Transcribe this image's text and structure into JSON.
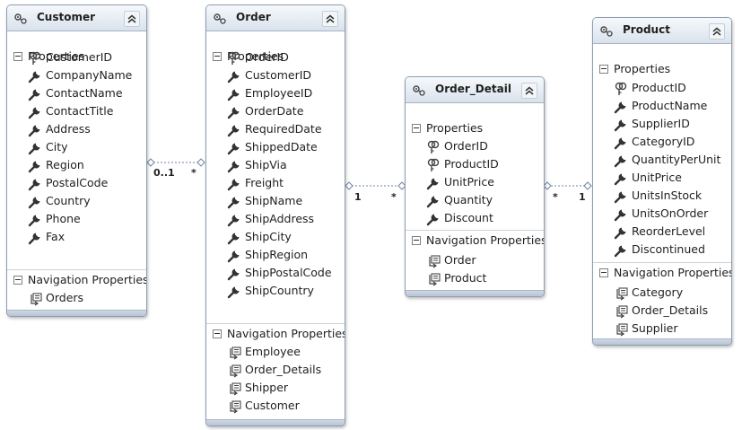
{
  "colors": {
    "header_top": "#f6f9fc",
    "header_bottom": "#d9e2ec",
    "border": "#8c9db3",
    "connector": "#6f86a3"
  },
  "section_labels": {
    "properties": "Properties",
    "navigation": "Navigation Properties"
  },
  "entities": {
    "customer": {
      "name": "Customer",
      "properties": [
        {
          "name": "CustomerID",
          "icon": "key-icon"
        },
        {
          "name": "CompanyName",
          "icon": "wrench-icon"
        },
        {
          "name": "ContactName",
          "icon": "wrench-icon"
        },
        {
          "name": "ContactTitle",
          "icon": "wrench-icon"
        },
        {
          "name": "Address",
          "icon": "wrench-icon"
        },
        {
          "name": "City",
          "icon": "wrench-icon"
        },
        {
          "name": "Region",
          "icon": "wrench-icon"
        },
        {
          "name": "PostalCode",
          "icon": "wrench-icon"
        },
        {
          "name": "Country",
          "icon": "wrench-icon"
        },
        {
          "name": "Phone",
          "icon": "wrench-icon"
        },
        {
          "name": "Fax",
          "icon": "wrench-icon"
        }
      ],
      "navigation": [
        "Orders"
      ]
    },
    "order": {
      "name": "Order",
      "properties": [
        {
          "name": "OrderID",
          "icon": "key-icon"
        },
        {
          "name": "CustomerID",
          "icon": "wrench-icon"
        },
        {
          "name": "EmployeeID",
          "icon": "wrench-icon"
        },
        {
          "name": "OrderDate",
          "icon": "wrench-icon"
        },
        {
          "name": "RequiredDate",
          "icon": "wrench-icon"
        },
        {
          "name": "ShippedDate",
          "icon": "wrench-icon"
        },
        {
          "name": "ShipVia",
          "icon": "wrench-icon"
        },
        {
          "name": "Freight",
          "icon": "wrench-icon"
        },
        {
          "name": "ShipName",
          "icon": "wrench-icon"
        },
        {
          "name": "ShipAddress",
          "icon": "wrench-icon"
        },
        {
          "name": "ShipCity",
          "icon": "wrench-icon"
        },
        {
          "name": "ShipRegion",
          "icon": "wrench-icon"
        },
        {
          "name": "ShipPostalCode",
          "icon": "wrench-icon"
        },
        {
          "name": "ShipCountry",
          "icon": "wrench-icon"
        }
      ],
      "navigation": [
        "Employee",
        "Order_Details",
        "Shipper",
        "Customer"
      ]
    },
    "order_detail": {
      "name": "Order_Detail",
      "properties": [
        {
          "name": "OrderID",
          "icon": "key-icon"
        },
        {
          "name": "ProductID",
          "icon": "key-icon"
        },
        {
          "name": "UnitPrice",
          "icon": "wrench-icon"
        },
        {
          "name": "Quantity",
          "icon": "wrench-icon"
        },
        {
          "name": "Discount",
          "icon": "wrench-icon"
        }
      ],
      "navigation": [
        "Order",
        "Product"
      ]
    },
    "product": {
      "name": "Product",
      "properties": [
        {
          "name": "ProductID",
          "icon": "key-icon"
        },
        {
          "name": "ProductName",
          "icon": "wrench-icon"
        },
        {
          "name": "SupplierID",
          "icon": "wrench-icon"
        },
        {
          "name": "CategoryID",
          "icon": "wrench-icon"
        },
        {
          "name": "QuantityPerUnit",
          "icon": "wrench-icon"
        },
        {
          "name": "UnitPrice",
          "icon": "wrench-icon"
        },
        {
          "name": "UnitsInStock",
          "icon": "wrench-icon"
        },
        {
          "name": "UnitsOnOrder",
          "icon": "wrench-icon"
        },
        {
          "name": "ReorderLevel",
          "icon": "wrench-icon"
        },
        {
          "name": "Discontinued",
          "icon": "wrench-icon"
        }
      ],
      "navigation": [
        "Category",
        "Order_Details",
        "Supplier"
      ]
    }
  },
  "associations": [
    {
      "from": "customer",
      "to": "order",
      "from_multiplicity": "0..1",
      "to_multiplicity": "*"
    },
    {
      "from": "order",
      "to": "order_detail",
      "from_multiplicity": "1",
      "to_multiplicity": "*"
    },
    {
      "from": "order_detail",
      "to": "product",
      "from_multiplicity": "*",
      "to_multiplicity": "1"
    }
  ]
}
